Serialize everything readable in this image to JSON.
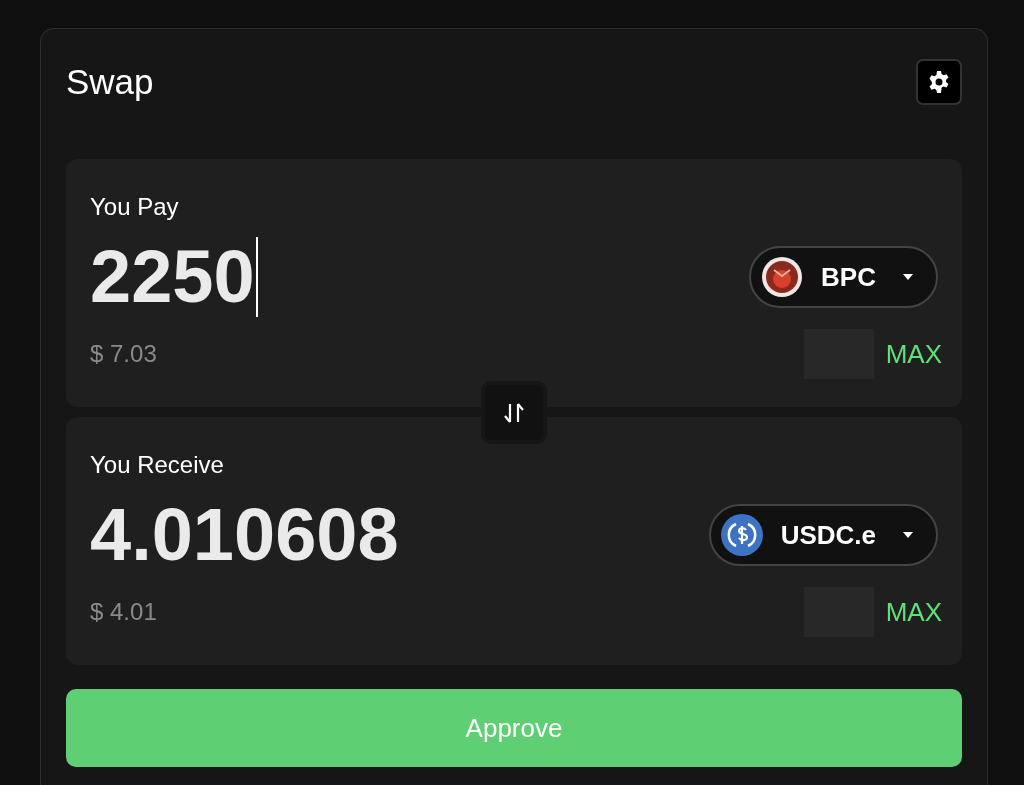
{
  "title": "Swap",
  "pay": {
    "label": "You Pay",
    "amount": "2250",
    "focused": true,
    "usd_value": "$ 7.03",
    "token": {
      "symbol": "BPC",
      "kind": "emblem"
    },
    "max_label": "MAX"
  },
  "receive": {
    "label": "You Receive",
    "amount": "4.010608",
    "focused": false,
    "usd_value": "$ 4.01",
    "token": {
      "symbol": "USDC.e",
      "kind": "dollar"
    },
    "max_label": "MAX"
  },
  "approve_button": "Approve"
}
